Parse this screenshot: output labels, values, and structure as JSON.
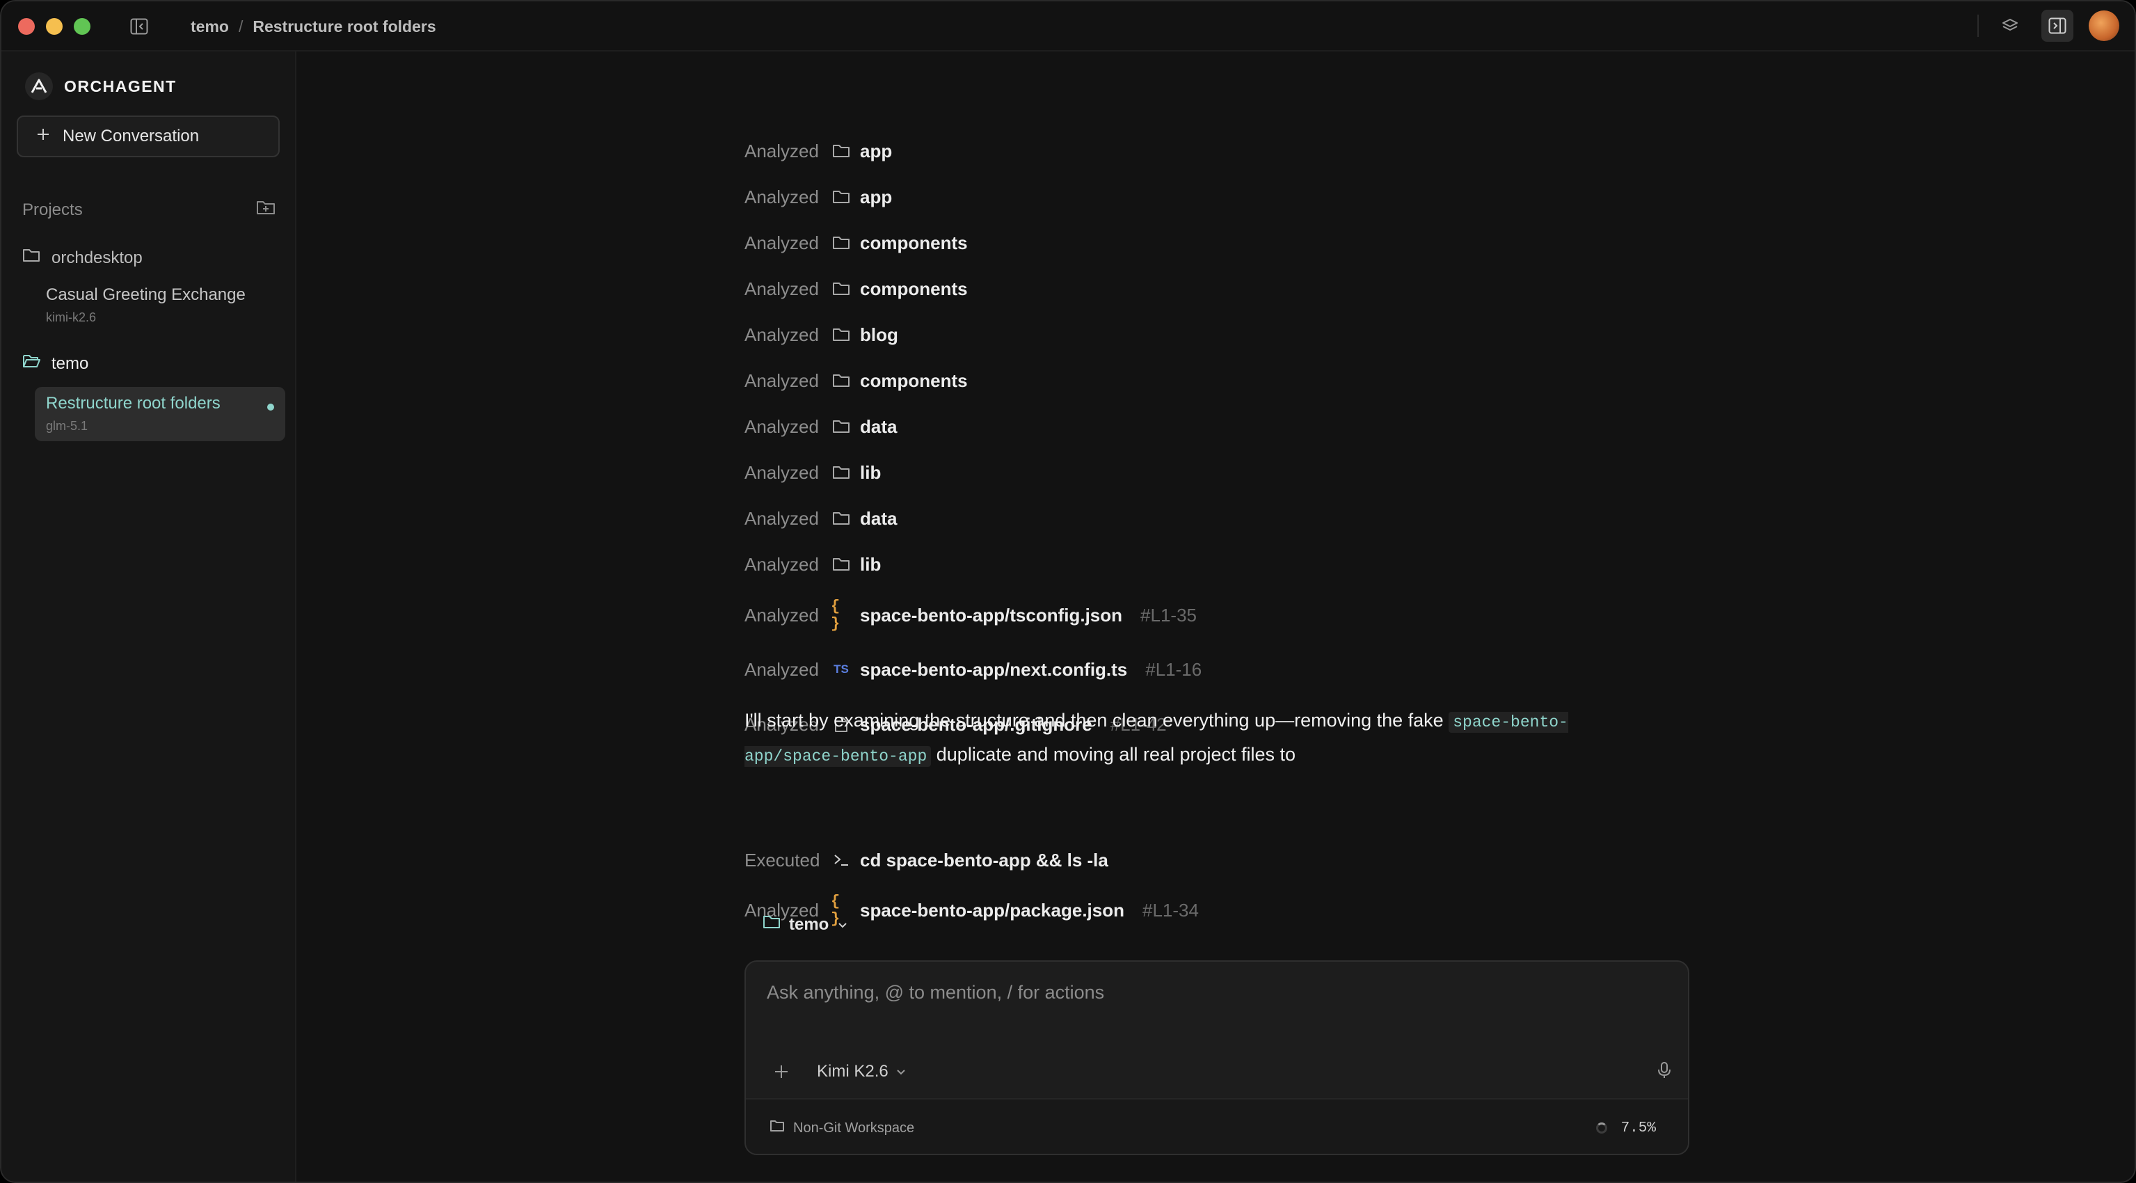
{
  "window": {
    "breadcrumb_project": "temo",
    "breadcrumb_sep": "/",
    "breadcrumb_title": "Restructure root folders"
  },
  "sidebar": {
    "brand": "ORCHAGENT",
    "new_conversation": "New Conversation",
    "projects_label": "Projects",
    "projects": [
      {
        "name": "orchdesktop",
        "conversations": [
          {
            "title": "Casual Greeting Exchange",
            "model": "kimi-k2.6"
          }
        ]
      },
      {
        "name": "temo",
        "conversations": [
          {
            "title": "Restructure root folders",
            "model": "glm-5.1",
            "active": true
          }
        ]
      }
    ]
  },
  "activity": [
    {
      "verb": "Analyzed",
      "icon": "folder-icon",
      "name": "app"
    },
    {
      "verb": "Analyzed",
      "icon": "folder-icon",
      "name": "app"
    },
    {
      "verb": "Analyzed",
      "icon": "folder-icon",
      "name": "components"
    },
    {
      "verb": "Analyzed",
      "icon": "folder-icon",
      "name": "components"
    },
    {
      "verb": "Analyzed",
      "icon": "folder-icon",
      "name": "blog"
    },
    {
      "verb": "Analyzed",
      "icon": "folder-icon",
      "name": "components"
    },
    {
      "verb": "Analyzed",
      "icon": "folder-icon",
      "name": "data"
    },
    {
      "verb": "Analyzed",
      "icon": "folder-icon",
      "name": "lib"
    },
    {
      "verb": "Analyzed",
      "icon": "folder-icon",
      "name": "data"
    },
    {
      "verb": "Analyzed",
      "icon": "folder-icon",
      "name": "lib"
    },
    {
      "verb": "Analyzed",
      "icon": "json-icon",
      "name": "space-bento-app/tsconfig.json",
      "ref": "#L1-35"
    },
    {
      "verb": "Analyzed",
      "icon": "typescript-icon",
      "name": "space-bento-app/next.config.ts",
      "ref": "#L1-16"
    },
    {
      "verb": "Analyzed",
      "icon": "file-icon",
      "name": "space-bento-app/.gitignore",
      "ref": "#L1-42"
    }
  ],
  "message": {
    "text_before": "I'll start by examining the structure and then clean everything up—removing the fake",
    "code": "space-bento-app/space-bento-app",
    "text_after": "duplicate and moving all real project files to"
  },
  "activity_after": [
    {
      "verb": "Executed",
      "icon": "terminal-icon",
      "name": "cd space-bento-app && ls -la"
    },
    {
      "verb": "Analyzed",
      "icon": "json-icon",
      "name": "space-bento-app/package.json",
      "ref": "#L1-34"
    }
  ],
  "composer": {
    "folder": "temo",
    "placeholder": "Ask anything, @ to mention, / for actions",
    "model": "Kimi K2.6",
    "workspace": "Non-Git Workspace",
    "context_usage": "7.5%"
  },
  "colors": {
    "accent": "#8fd5cc",
    "json_icon": "#e2a03f",
    "ts_icon": "#5b7fe0"
  }
}
